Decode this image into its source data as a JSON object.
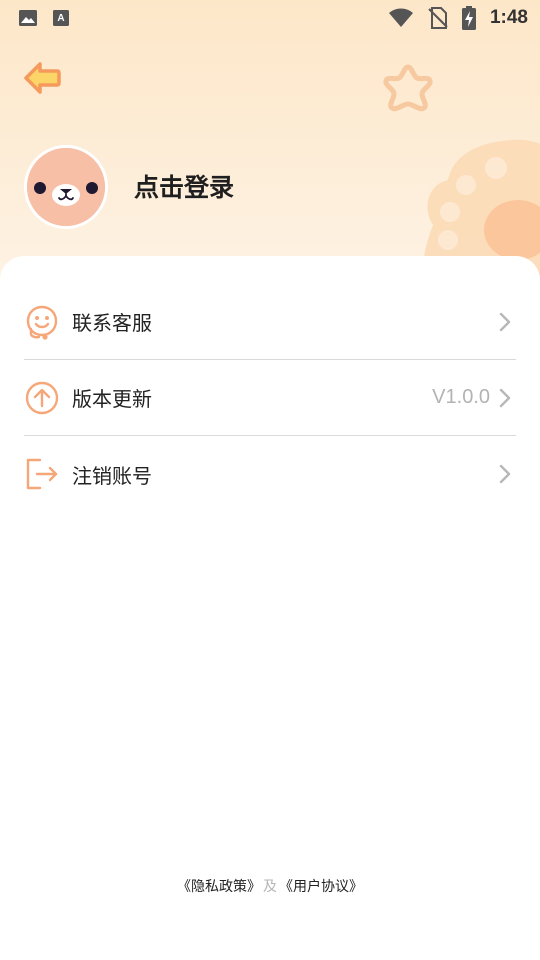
{
  "status_bar": {
    "time": "1:48",
    "left_icons": [
      "image-icon",
      "text-a-icon"
    ],
    "right_icons": [
      "wifi-icon",
      "no-sim-icon",
      "battery-charging-icon"
    ]
  },
  "header": {
    "back_icon": "back-arrow-icon",
    "avatar_icon": "bear-face-icon",
    "login_label": "点击登录"
  },
  "menu": {
    "items": [
      {
        "label": "联系客服",
        "icon": "customer-service-icon",
        "value": ""
      },
      {
        "label": "版本更新",
        "icon": "upload-arrow-icon",
        "value": "V1.0.0"
      },
      {
        "label": "注销账号",
        "icon": "logout-icon",
        "value": ""
      }
    ]
  },
  "footer": {
    "privacy_label": "《隐私政策》",
    "separator": "及",
    "agreement_label": "《用户协议》"
  },
  "colors": {
    "accent": "#f5a77a",
    "avatar_bg": "#f7bfa6",
    "header_bg_top": "#fde7c9",
    "chevron": "#b8b8b8"
  }
}
